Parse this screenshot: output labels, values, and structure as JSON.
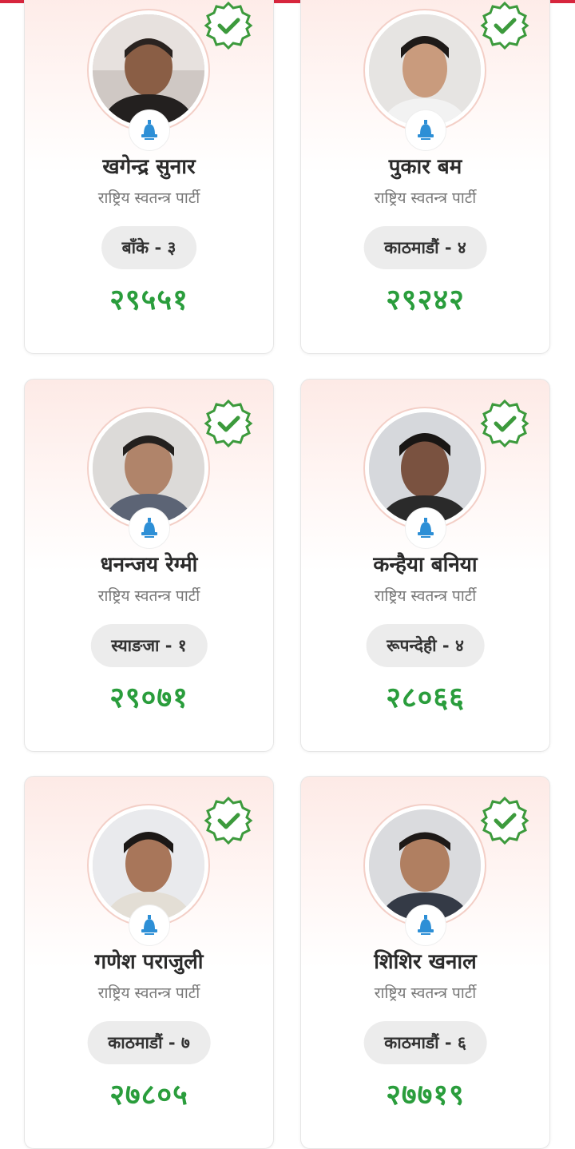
{
  "candidates": [
    {
      "name": "खगेन्द्र सुनार",
      "party": "राष्ट्रिय स्वतन्त्र पार्टी",
      "constituency": "बाँके - ३",
      "votes": "२९५५१"
    },
    {
      "name": "पुकार बम",
      "party": "राष्ट्रिय स्वतन्त्र पार्टी",
      "constituency": "काठमाडौं - ४",
      "votes": "२९२४२"
    },
    {
      "name": "धनन्जय रेग्मी",
      "party": "राष्ट्रिय स्वतन्त्र पार्टी",
      "constituency": "स्याङजा - १",
      "votes": "२९०७१"
    },
    {
      "name": "कन्हैया बनिया",
      "party": "राष्ट्रिय स्वतन्त्र पार्टी",
      "constituency": "रूपन्देही - ४",
      "votes": "२८०६६"
    },
    {
      "name": "गणेश पराजुली",
      "party": "राष्ट्रिय स्वतन्त्र पार्टी",
      "constituency": "काठमाडौं - ७",
      "votes": "२७८०५"
    },
    {
      "name": "शिशिर खनाल",
      "party": "राष्ट्रिय स्वतन्त्र पार्टी",
      "constituency": "काठमाडौं - ६",
      "votes": "२७७१९"
    }
  ],
  "colors": {
    "accent": "#d7263d",
    "votes": "#2a9d3c",
    "verified": "#3c9a3c",
    "party_symbol": "#2d8fd6"
  },
  "icons": {
    "verified": "verified-badge-icon",
    "party_symbol": "bell-icon"
  }
}
